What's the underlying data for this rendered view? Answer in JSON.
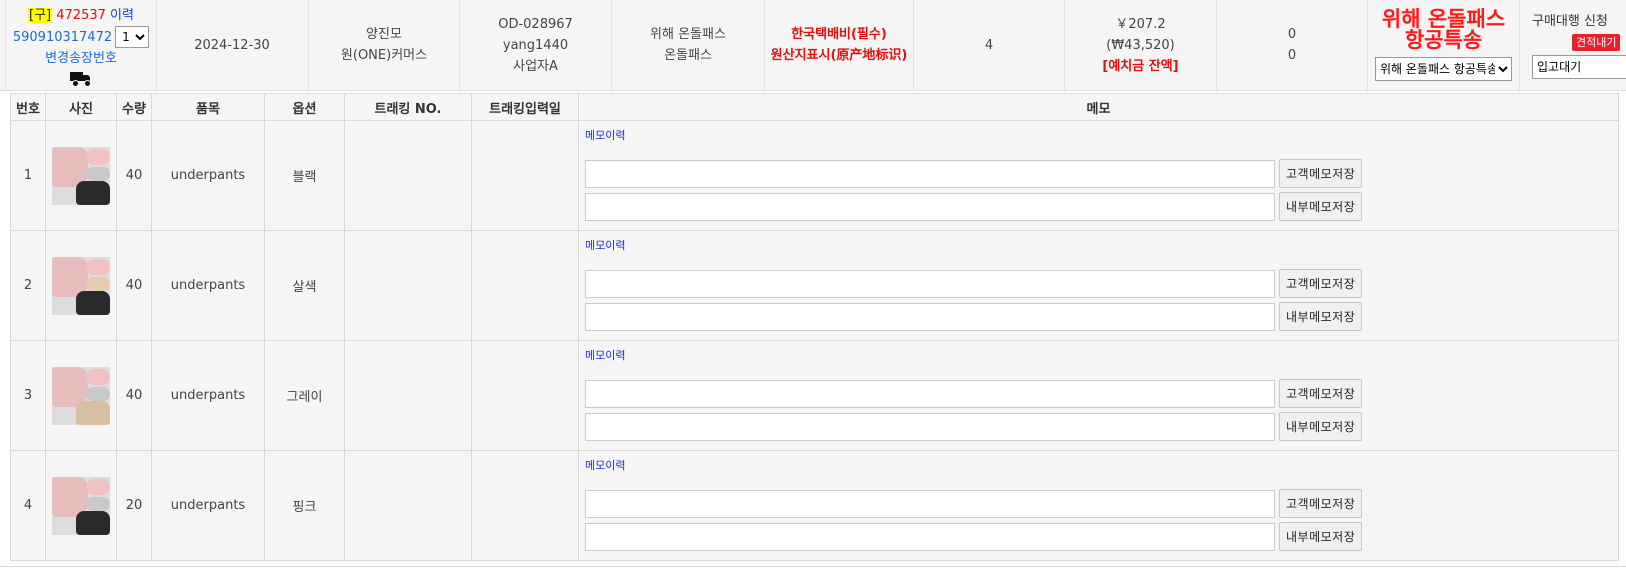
{
  "order": {
    "old_tag": "[구]",
    "order_no": "472537",
    "history_label": "이력",
    "tracking_code": "590910317472",
    "box_count": "1",
    "change_tracking": "변경송장번호",
    "date": "2024-12-30",
    "customer_name": "양진모",
    "customer_company": "원(ONE)커머스",
    "od_code": "OD-028967",
    "user_id": "yang1440",
    "business_type": "사업자A",
    "ship_line1": "위해 온돌패스",
    "ship_line2": "온돌패스",
    "fee_line1": "한국택배비(필수)",
    "fee_line2": "원산지표시(原产地标识)",
    "total_qty": "4",
    "amount_cny": "￥207.2",
    "amount_krw": "(₩43,520)",
    "deposit_label": "[예치금 잔액]",
    "count_a": "0",
    "count_b": "0",
    "shipping_title": "위해 온돌패스 항공특송",
    "shipping_select": "위해 온돌패스 항공특송",
    "purchase_label": "구매대행 신청",
    "quote_button": "견적내기",
    "status_select": "입고대기"
  },
  "table": {
    "headers": [
      "번호",
      "사진",
      "수량",
      "품목",
      "옵션",
      "트래킹 NO.",
      "트래킹입력일",
      "메모"
    ],
    "memo_history_label": "메모이력",
    "customer_memo_button": "고객메모저장",
    "internal_memo_button": "내부메모저장",
    "rows": [
      {
        "no": "1",
        "qty": "40",
        "item": "underpants",
        "option": "블랙",
        "tracking": "",
        "tracking_date": ""
      },
      {
        "no": "2",
        "qty": "40",
        "item": "underpants",
        "option": "살색",
        "tracking": "",
        "tracking_date": ""
      },
      {
        "no": "3",
        "qty": "40",
        "item": "underpants",
        "option": "그레이",
        "tracking": "",
        "tracking_date": ""
      },
      {
        "no": "4",
        "qty": "20",
        "item": "underpants",
        "option": "핑크",
        "tracking": "",
        "tracking_date": ""
      }
    ]
  },
  "colors": {
    "accent_red": "#e01010",
    "link_blue": "#1a6bd6",
    "memo_blue": "#1a2fd0",
    "row_bg": "#f5f5f5"
  },
  "icons": [
    "truck-icon",
    "product-thumbnail"
  ]
}
